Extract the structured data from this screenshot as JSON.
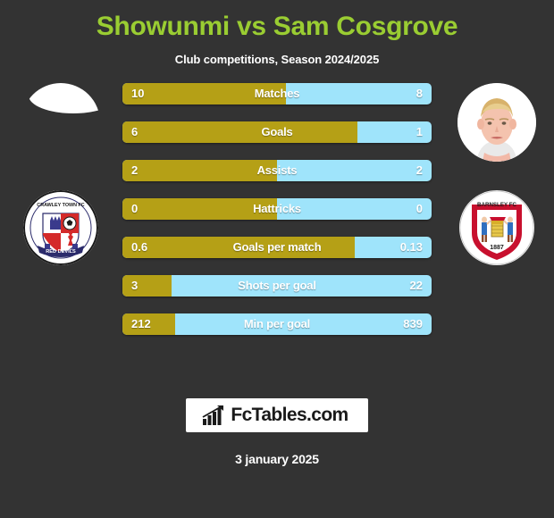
{
  "header": {
    "title": "Showunmi vs Sam Cosgrove",
    "subtitle": "Club competitions, Season 2024/2025",
    "title_color": "#9acd32"
  },
  "colors": {
    "background": "#333333",
    "home_bar": "#b5a016",
    "away_bar": "#9fe4fb",
    "text": "#ffffff"
  },
  "players": {
    "home": {
      "photo": "player-photo-placeholder",
      "club_crest": "crawley-town-fc-crest",
      "crest_text_top": "CRAWLEY TOWN FC",
      "crest_text_bottom": "RED DEVILS"
    },
    "away": {
      "photo": "player-photo-sam-cosgrove",
      "club_crest": "barnsley-fc-crest",
      "crest_text_top": "BARNSLEY FC",
      "crest_text_bottom": "1887"
    }
  },
  "chart_data": {
    "type": "bar",
    "title": "Showunmi vs Sam Cosgrove",
    "subtitle": "Club competitions, Season 2024/2025",
    "orientation": "horizontal-diverging",
    "series": [
      {
        "name": "Showunmi",
        "color": "#b5a016"
      },
      {
        "name": "Sam Cosgrove",
        "color": "#9fe4fb"
      }
    ],
    "categories": [
      "Matches",
      "Goals",
      "Assists",
      "Hattricks",
      "Goals per match",
      "Shots per goal",
      "Min per goal"
    ],
    "rows": [
      {
        "label": "Matches",
        "home": "10",
        "away": "8",
        "home_pct": 53
      },
      {
        "label": "Goals",
        "home": "6",
        "away": "1",
        "home_pct": 76
      },
      {
        "label": "Assists",
        "home": "2",
        "away": "2",
        "home_pct": 50
      },
      {
        "label": "Hattricks",
        "home": "0",
        "away": "0",
        "home_pct": 50
      },
      {
        "label": "Goals per match",
        "home": "0.6",
        "away": "0.13",
        "home_pct": 75
      },
      {
        "label": "Shots per goal",
        "home": "3",
        "away": "22",
        "home_pct": 16
      },
      {
        "label": "Min per goal",
        "home": "212",
        "away": "839",
        "home_pct": 17
      }
    ]
  },
  "footer": {
    "logo_text": "FcTables.com",
    "logo_icon": "bar-chart-arrow-icon",
    "date": "3 january 2025"
  }
}
